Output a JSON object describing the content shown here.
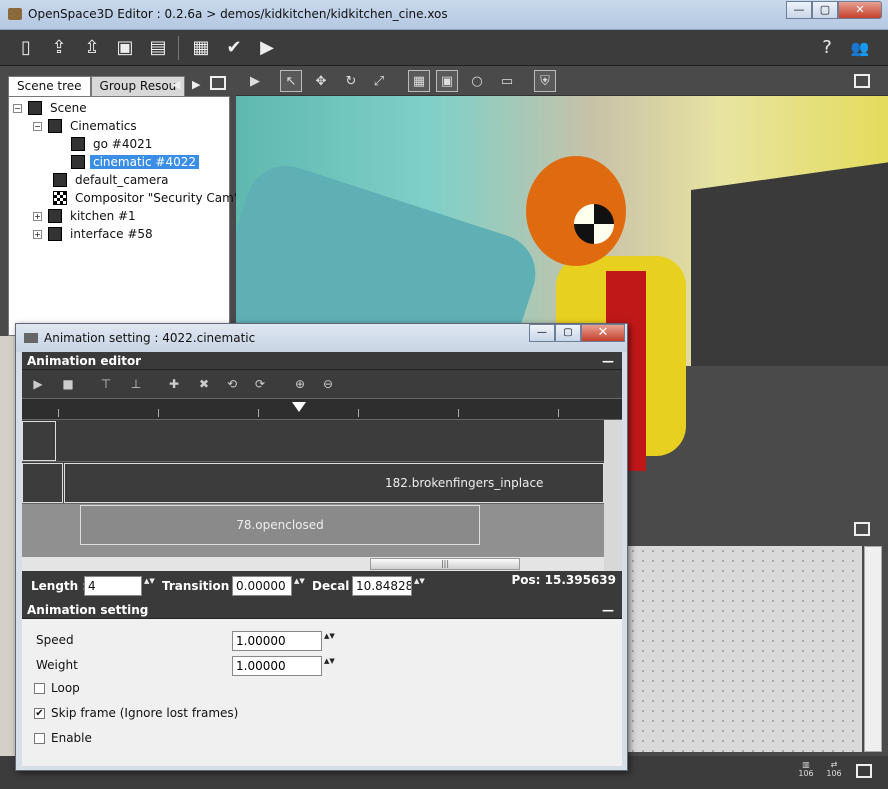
{
  "window": {
    "title": "OpenSpace3D Editor : 0.2.6a > demos/kidkitchen/kidkitchen_cine.xos",
    "min": "—",
    "max": "▢",
    "close": "✕"
  },
  "toolbar": {
    "new": "▯",
    "open": "⇪",
    "folder_add": "⇫",
    "save": "▣",
    "save_as": "▤",
    "calc": "▦",
    "tools": "✔",
    "play": "▶",
    "help": "?",
    "users": "👥"
  },
  "left": {
    "tabs": [
      "Scene tree",
      "Group Resou"
    ],
    "tab_prev": "◀",
    "tab_next": "▶",
    "tree": [
      {
        "label": "Scene",
        "level": 0,
        "expander": "−"
      },
      {
        "label": "Cinematics",
        "level": 1,
        "expander": "−"
      },
      {
        "label": "go #4021",
        "level": 2,
        "expander": ""
      },
      {
        "label": "cinematic #4022",
        "level": 2,
        "expander": "",
        "selected": true
      },
      {
        "label": "default_camera",
        "level": 1,
        "expander": ""
      },
      {
        "label": "Compositor \"Security Cam\"",
        "level": 1,
        "expander": ""
      },
      {
        "label": "kitchen #1",
        "level": 1,
        "expander": "+"
      },
      {
        "label": "interface #58",
        "level": 1,
        "expander": "+"
      }
    ]
  },
  "viewport_toolbar": {
    "play": "▶",
    "select": "↖",
    "move": "✥",
    "rotate": "↻",
    "scale": "⤢",
    "grid": "▦",
    "box": "▣",
    "sphere": "○",
    "screen": "▭",
    "shield": "⛨"
  },
  "dialog": {
    "title": "Animation setting : 4022.cinematic",
    "min": "—",
    "max": "▢",
    "close": "✕",
    "editor_header": "Animation editor",
    "collapse": "—",
    "anim_tools": {
      "play": "▶",
      "stop": "■",
      "add_track": "⊤",
      "del_track": "⊥",
      "add_key": "✚",
      "del_key": "✖",
      "link": "⟲",
      "unlink": "⟳",
      "zoom_in": "⊕",
      "zoom_out": "⊖"
    },
    "clips": {
      "track2": "182.brokenfingers_inplace",
      "track3": "78.openclosed"
    },
    "scroll_grip": "|||",
    "params": {
      "length_label": "Length :",
      "length_value": "4",
      "transition_label": "Transition :",
      "transition_value": "0.00000",
      "decal_label": "Decal :",
      "decal_value": "10.84828",
      "pos_label": "Pos: 15.395639",
      "spin": "▲▼"
    },
    "setting_header": "Animation setting",
    "speed_label": "Speed",
    "speed_value": "1.00000",
    "weight_label": "Weight",
    "weight_value": "1.00000",
    "loop_label": "Loop",
    "skip_label": "Skip frame (Ignore lost frames)",
    "enable_label": "Enable",
    "check_mark": "✔"
  },
  "status": {
    "a": "106",
    "b": "106"
  }
}
